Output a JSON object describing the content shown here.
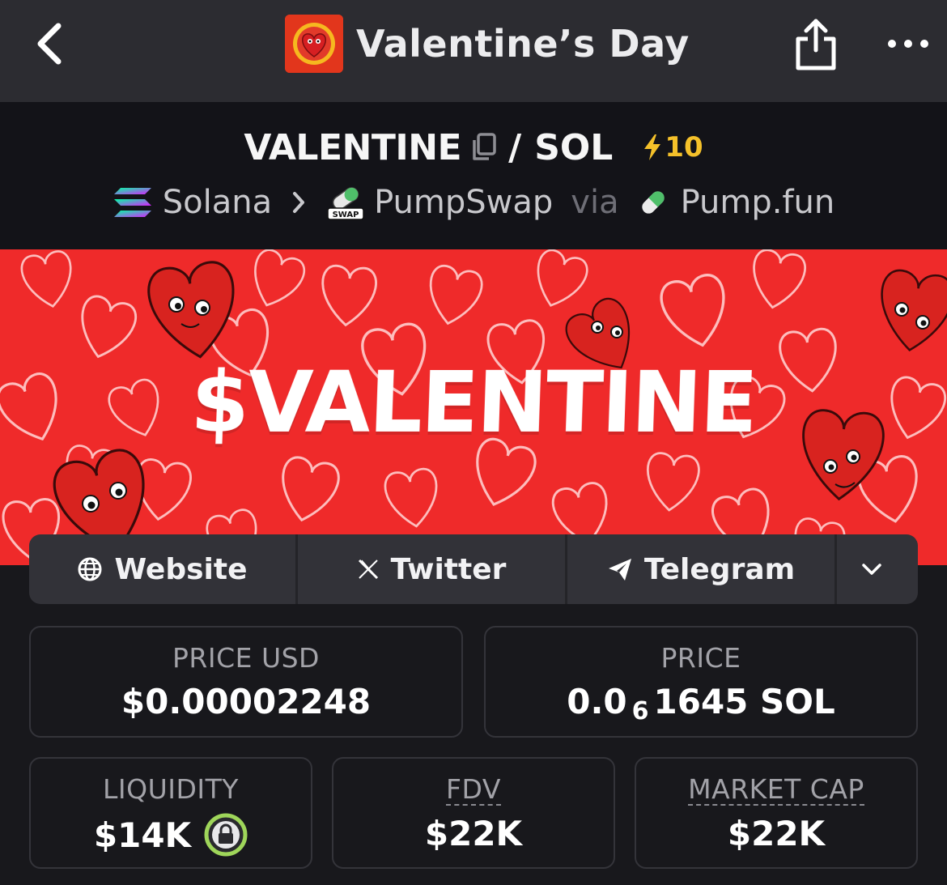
{
  "nav": {
    "title": "Valentine’s Day",
    "back_icon": "chevron-left-icon",
    "share_icon": "share-icon",
    "more_icon": "more-horizontal-icon"
  },
  "pair": {
    "base": "VALENTINE",
    "separator": "/",
    "quote": "SOL",
    "boost_count": "10",
    "boost_color": "#f5c12a"
  },
  "route": {
    "chain": "Solana",
    "dex": "PumpSwap",
    "dex_badge": "SWAP",
    "via": "via",
    "launchpad": "Pump.fun"
  },
  "banner": {
    "text": "$VALENTINE",
    "background_color": "#ef2a2a"
  },
  "links": {
    "website": "Website",
    "twitter": "Twitter",
    "telegram": "Telegram"
  },
  "stats": {
    "price_usd_label": "PRICE USD",
    "price_usd_value": "$0.00002248",
    "price_label": "PRICE",
    "price_prefix": "0.0",
    "price_zeros": "6",
    "price_suffix": "1645 SOL",
    "liquidity_label": "LIQUIDITY",
    "liquidity_value": "$14K",
    "fdv_label": "FDV",
    "fdv_value": "$22K",
    "mcap_label": "MARKET CAP",
    "mcap_value": "$22K"
  }
}
